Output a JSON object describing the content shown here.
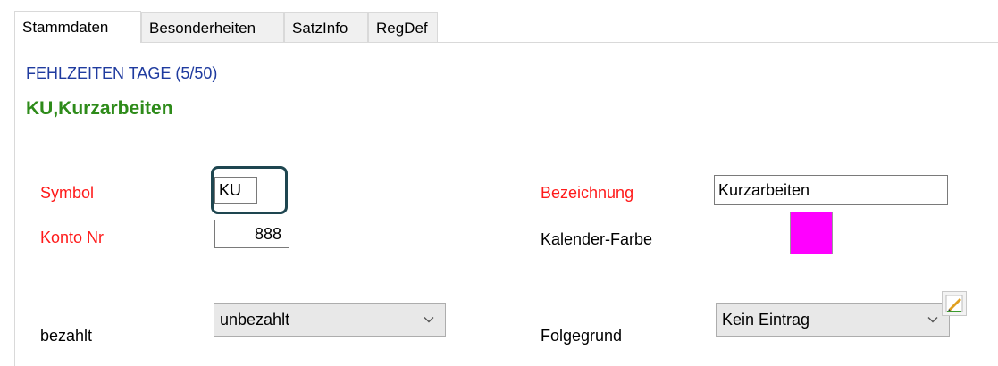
{
  "tabs": [
    {
      "label": "Stammdaten",
      "active": true
    },
    {
      "label": "Besonderheiten",
      "active": false
    },
    {
      "label": "SatzInfo",
      "active": false
    },
    {
      "label": "RegDef",
      "active": false
    }
  ],
  "header": {
    "subtitle": "FEHLZEITEN TAGE (5/50)",
    "title": "KU,Kurzarbeiten"
  },
  "form": {
    "symbol_label": "Symbol",
    "symbol_value": "KU",
    "konto_label": "Konto Nr",
    "konto_value": "888",
    "bezeichnung_label": "Bezeichnung",
    "bezeichnung_value": "Kurzarbeiten",
    "kalender_label": "Kalender-Farbe",
    "kalender_color": "#ff00ff",
    "bezahlt_label": "bezahlt",
    "bezahlt_value": "unbezahlt",
    "folgegrund_label": "Folgegrund",
    "folgegrund_value": "Kein Eintrag"
  },
  "colors": {
    "required_label": "#ff1a1a",
    "subtitle": "#1f3b9f",
    "title": "#2e8b1a",
    "highlight_border": "#1e4650"
  },
  "icons": {
    "dropdown": "chevron-down-icon",
    "edit": "pencil-edit-icon"
  }
}
